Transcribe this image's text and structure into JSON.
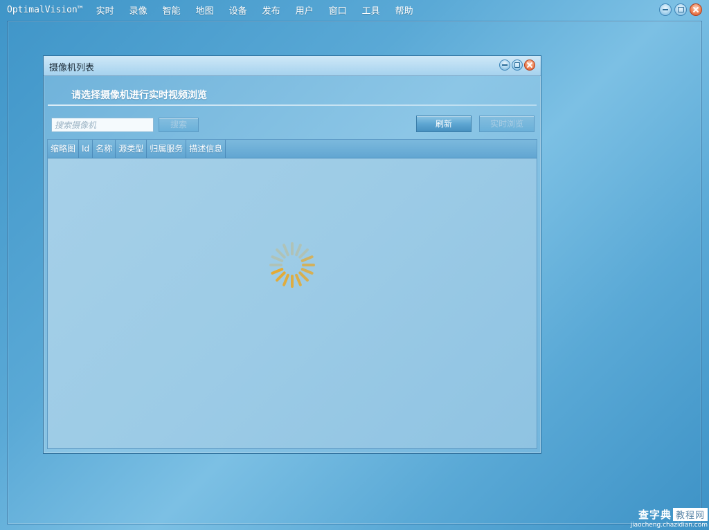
{
  "app": {
    "title": "OptimalVision™"
  },
  "menu": [
    "实时",
    "录像",
    "智能",
    "地图",
    "设备",
    "发布",
    "用户",
    "窗口",
    "工具",
    "帮助"
  ],
  "dialog": {
    "title": "摄像机列表",
    "header": "请选择摄像机进行实时视频浏览",
    "search": {
      "placeholder": "搜索摄像机",
      "value": "",
      "button": "搜索"
    },
    "buttons": {
      "refresh": "刷新",
      "live_preview": "实时浏览"
    },
    "table": {
      "columns": [
        "缩略图",
        "Id",
        "名称",
        "源类型",
        "归属服务",
        "描述信息"
      ],
      "rows": []
    },
    "loading": true
  },
  "colors": {
    "spinner": "#f0a516",
    "accent": "#4790c0"
  },
  "watermark": {
    "main": "查字典",
    "box": "教程网",
    "sub": "jiaocheng.chazidian.com"
  }
}
